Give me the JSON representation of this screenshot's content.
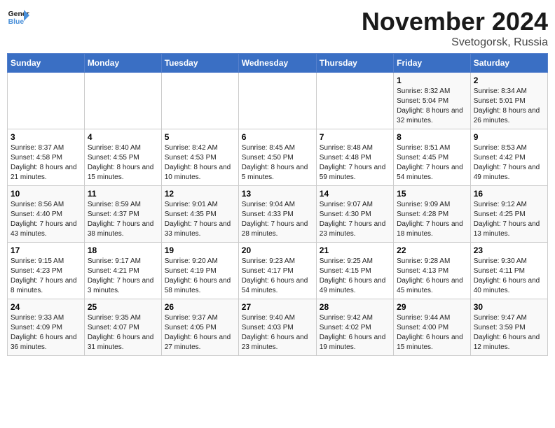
{
  "logo": {
    "line1": "General",
    "line2": "Blue"
  },
  "title": "November 2024",
  "location": "Svetogorsk, Russia",
  "days_header": [
    "Sunday",
    "Monday",
    "Tuesday",
    "Wednesday",
    "Thursday",
    "Friday",
    "Saturday"
  ],
  "weeks": [
    [
      {
        "day": "",
        "info": ""
      },
      {
        "day": "",
        "info": ""
      },
      {
        "day": "",
        "info": ""
      },
      {
        "day": "",
        "info": ""
      },
      {
        "day": "",
        "info": ""
      },
      {
        "day": "1",
        "info": "Sunrise: 8:32 AM\nSunset: 5:04 PM\nDaylight: 8 hours and 32 minutes."
      },
      {
        "day": "2",
        "info": "Sunrise: 8:34 AM\nSunset: 5:01 PM\nDaylight: 8 hours and 26 minutes."
      }
    ],
    [
      {
        "day": "3",
        "info": "Sunrise: 8:37 AM\nSunset: 4:58 PM\nDaylight: 8 hours and 21 minutes."
      },
      {
        "day": "4",
        "info": "Sunrise: 8:40 AM\nSunset: 4:55 PM\nDaylight: 8 hours and 15 minutes."
      },
      {
        "day": "5",
        "info": "Sunrise: 8:42 AM\nSunset: 4:53 PM\nDaylight: 8 hours and 10 minutes."
      },
      {
        "day": "6",
        "info": "Sunrise: 8:45 AM\nSunset: 4:50 PM\nDaylight: 8 hours and 5 minutes."
      },
      {
        "day": "7",
        "info": "Sunrise: 8:48 AM\nSunset: 4:48 PM\nDaylight: 7 hours and 59 minutes."
      },
      {
        "day": "8",
        "info": "Sunrise: 8:51 AM\nSunset: 4:45 PM\nDaylight: 7 hours and 54 minutes."
      },
      {
        "day": "9",
        "info": "Sunrise: 8:53 AM\nSunset: 4:42 PM\nDaylight: 7 hours and 49 minutes."
      }
    ],
    [
      {
        "day": "10",
        "info": "Sunrise: 8:56 AM\nSunset: 4:40 PM\nDaylight: 7 hours and 43 minutes."
      },
      {
        "day": "11",
        "info": "Sunrise: 8:59 AM\nSunset: 4:37 PM\nDaylight: 7 hours and 38 minutes."
      },
      {
        "day": "12",
        "info": "Sunrise: 9:01 AM\nSunset: 4:35 PM\nDaylight: 7 hours and 33 minutes."
      },
      {
        "day": "13",
        "info": "Sunrise: 9:04 AM\nSunset: 4:33 PM\nDaylight: 7 hours and 28 minutes."
      },
      {
        "day": "14",
        "info": "Sunrise: 9:07 AM\nSunset: 4:30 PM\nDaylight: 7 hours and 23 minutes."
      },
      {
        "day": "15",
        "info": "Sunrise: 9:09 AM\nSunset: 4:28 PM\nDaylight: 7 hours and 18 minutes."
      },
      {
        "day": "16",
        "info": "Sunrise: 9:12 AM\nSunset: 4:25 PM\nDaylight: 7 hours and 13 minutes."
      }
    ],
    [
      {
        "day": "17",
        "info": "Sunrise: 9:15 AM\nSunset: 4:23 PM\nDaylight: 7 hours and 8 minutes."
      },
      {
        "day": "18",
        "info": "Sunrise: 9:17 AM\nSunset: 4:21 PM\nDaylight: 7 hours and 3 minutes."
      },
      {
        "day": "19",
        "info": "Sunrise: 9:20 AM\nSunset: 4:19 PM\nDaylight: 6 hours and 58 minutes."
      },
      {
        "day": "20",
        "info": "Sunrise: 9:23 AM\nSunset: 4:17 PM\nDaylight: 6 hours and 54 minutes."
      },
      {
        "day": "21",
        "info": "Sunrise: 9:25 AM\nSunset: 4:15 PM\nDaylight: 6 hours and 49 minutes."
      },
      {
        "day": "22",
        "info": "Sunrise: 9:28 AM\nSunset: 4:13 PM\nDaylight: 6 hours and 45 minutes."
      },
      {
        "day": "23",
        "info": "Sunrise: 9:30 AM\nSunset: 4:11 PM\nDaylight: 6 hours and 40 minutes."
      }
    ],
    [
      {
        "day": "24",
        "info": "Sunrise: 9:33 AM\nSunset: 4:09 PM\nDaylight: 6 hours and 36 minutes."
      },
      {
        "day": "25",
        "info": "Sunrise: 9:35 AM\nSunset: 4:07 PM\nDaylight: 6 hours and 31 minutes."
      },
      {
        "day": "26",
        "info": "Sunrise: 9:37 AM\nSunset: 4:05 PM\nDaylight: 6 hours and 27 minutes."
      },
      {
        "day": "27",
        "info": "Sunrise: 9:40 AM\nSunset: 4:03 PM\nDaylight: 6 hours and 23 minutes."
      },
      {
        "day": "28",
        "info": "Sunrise: 9:42 AM\nSunset: 4:02 PM\nDaylight: 6 hours and 19 minutes."
      },
      {
        "day": "29",
        "info": "Sunrise: 9:44 AM\nSunset: 4:00 PM\nDaylight: 6 hours and 15 minutes."
      },
      {
        "day": "30",
        "info": "Sunrise: 9:47 AM\nSunset: 3:59 PM\nDaylight: 6 hours and 12 minutes."
      }
    ]
  ]
}
